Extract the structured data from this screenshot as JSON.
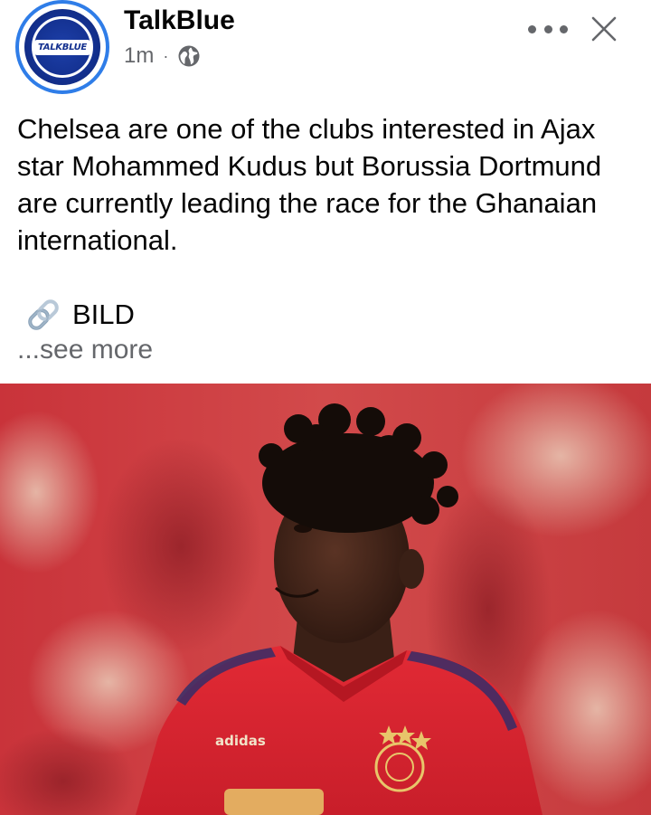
{
  "post": {
    "page_name": "TalkBlue",
    "avatar_text": "TALKBLUE",
    "time": "1m",
    "separator": "·",
    "audience_icon": "globe-icon",
    "text": "Chelsea are one of the clubs interested in Ajax star Mohammed Kudus but Borussia Dortmund are currently leading the race for the Ghanaian international.",
    "source_icon": "link-icon",
    "source": "BILD",
    "see_more": "...see more",
    "more_options_icon": "more-horizontal-icon",
    "close_icon": "close-icon"
  },
  "photo": {
    "description_icon": "player-photo",
    "shirt_brand": "adidas"
  },
  "colors": {
    "avatar_ring": "#2f7de8",
    "avatar_blue": "#13308f",
    "secondary_text": "#65676b",
    "primary_text": "#050505",
    "shirt_red": "#d9232f"
  }
}
